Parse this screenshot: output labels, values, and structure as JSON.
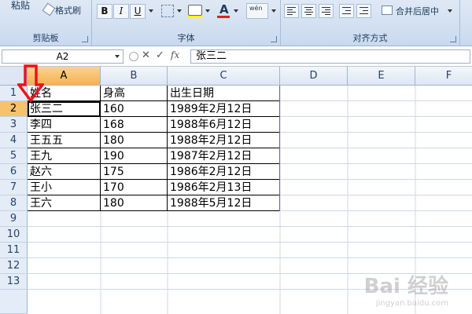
{
  "ribbon": {
    "paste_label": "粘贴",
    "format_painter_label": "格式刷",
    "clipboard_group": "剪贴板",
    "font_group": "字体",
    "align_group": "对齐方式",
    "merge_label": "合并后居中",
    "bold": "B",
    "italic": "I",
    "underline": "U",
    "font_color_letter": "A",
    "wen": "wén",
    "font_color_hex": "#e02020"
  },
  "formula_bar": {
    "name_box": "A2",
    "fx": "fx",
    "content": "张三二"
  },
  "columns": [
    "A",
    "B",
    "C",
    "D",
    "E",
    "F"
  ],
  "rows": [
    "1",
    "2",
    "3",
    "4",
    "5",
    "6",
    "7",
    "8",
    "9",
    "10",
    "11",
    "12",
    "13"
  ],
  "table": [
    [
      "姓名",
      "身高",
      "出生日期"
    ],
    [
      "张三二",
      "160",
      "1989年2月12日"
    ],
    [
      "李四",
      "168",
      "1988年6月12日"
    ],
    [
      "王五五",
      "180",
      "1988年2月12日"
    ],
    [
      "王九",
      "190",
      "1987年2月12日"
    ],
    [
      "赵六",
      "175",
      "1986年2月12日"
    ],
    [
      "王小",
      "170",
      "1986年2月13日"
    ],
    [
      "王六",
      "180",
      "1988年5月12日"
    ]
  ],
  "watermark": {
    "main": "Bai 经验",
    "sub": "jingyan.baidu.com"
  }
}
